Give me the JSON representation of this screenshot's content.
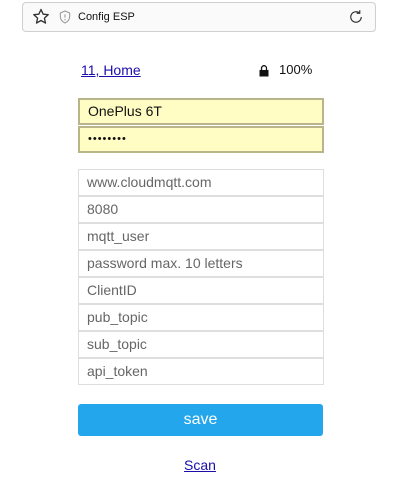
{
  "browser": {
    "title": "Config ESP"
  },
  "status": {
    "network_link": "11, Home",
    "battery": "100%"
  },
  "fields": {
    "wifi_ssid": "OnePlus 6T",
    "wifi_password_mask": "••••••••",
    "mqtt_server_placeholder": "www.cloudmqtt.com",
    "mqtt_port_placeholder": "8080",
    "mqtt_user_placeholder": "mqtt_user",
    "mqtt_password_placeholder": "password max. 10 letters",
    "client_id_placeholder": "ClientID",
    "pub_topic_placeholder": "pub_topic",
    "sub_topic_placeholder": "sub_topic",
    "api_token_placeholder": "api_token"
  },
  "actions": {
    "save_label": "save",
    "scan_label": "Scan"
  }
}
